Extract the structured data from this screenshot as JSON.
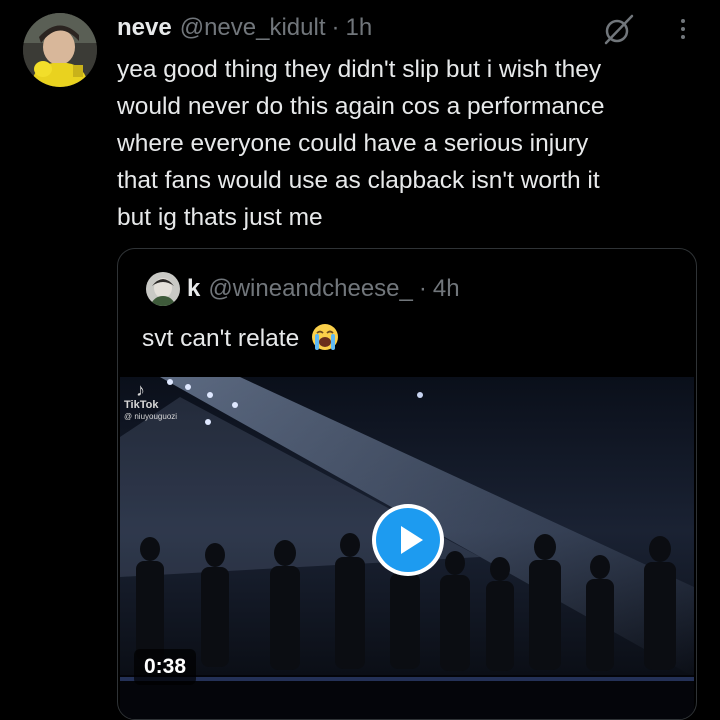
{
  "tweet": {
    "display_name": "neve",
    "handle": "@neve_kidult",
    "separator": "·",
    "time": "1h",
    "text_lines": [
      "yea good thing they didn't slip but i wish they",
      "would never do this again cos a performance",
      "where everyone could have a serious injury",
      "that fans would use as clapback isn't worth it",
      "but ig thats just me"
    ]
  },
  "quote": {
    "display_name": "k",
    "handle": "@wineandcheese_",
    "separator": "·",
    "time": "4h",
    "text": "svt can't relate",
    "emoji": "loudly-crying-face-emoji",
    "media": {
      "watermark_brand": "TikTok",
      "watermark_user": "@ niuyouguozi",
      "duration": "0:38"
    }
  },
  "icons": {
    "grok": "grok-icon",
    "more": "more-icon",
    "play": "play-icon",
    "tiktok": "tiktok-logo-icon"
  },
  "colors": {
    "background": "#000000",
    "text": "#e7e9ea",
    "muted": "#71767b",
    "border": "#2f3336",
    "play_accent": "#1d9bf0"
  }
}
